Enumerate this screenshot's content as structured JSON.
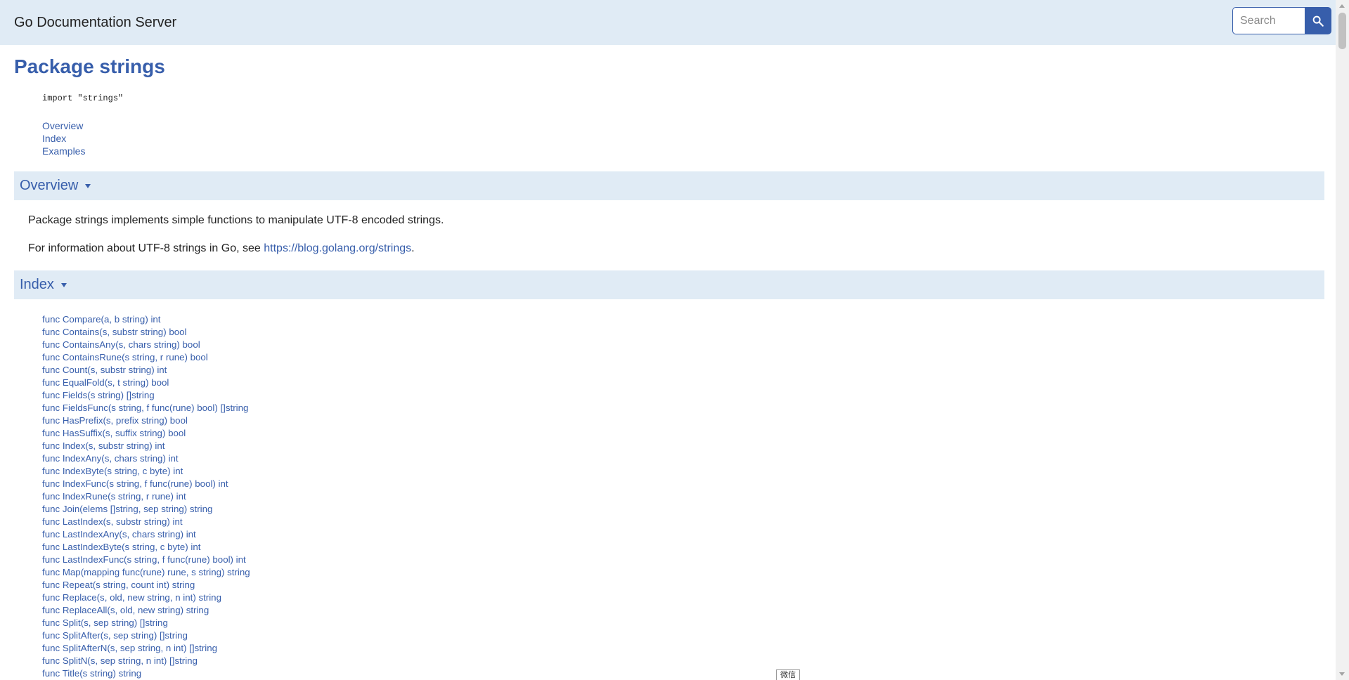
{
  "header": {
    "site_title": "Go Documentation Server",
    "search_placeholder": "Search",
    "search_icon": "search-icon"
  },
  "page": {
    "title": "Package strings",
    "import_line": "import \"strings\"",
    "toc": [
      "Overview",
      "Index",
      "Examples"
    ]
  },
  "overview": {
    "heading": "Overview",
    "toggle_icon": "triangle-down-icon",
    "paragraph1": "Package strings implements simple functions to manipulate UTF-8 encoded strings.",
    "paragraph2_prefix": "For information about UTF-8 strings in Go, see ",
    "paragraph2_link": "https://blog.golang.org/strings",
    "paragraph2_suffix": "."
  },
  "index": {
    "heading": "Index",
    "toggle_icon": "triangle-down-icon",
    "items": [
      "func Compare(a, b string) int",
      "func Contains(s, substr string) bool",
      "func ContainsAny(s, chars string) bool",
      "func ContainsRune(s string, r rune) bool",
      "func Count(s, substr string) int",
      "func EqualFold(s, t string) bool",
      "func Fields(s string) []string",
      "func FieldsFunc(s string, f func(rune) bool) []string",
      "func HasPrefix(s, prefix string) bool",
      "func HasSuffix(s, suffix string) bool",
      "func Index(s, substr string) int",
      "func IndexAny(s, chars string) int",
      "func IndexByte(s string, c byte) int",
      "func IndexFunc(s string, f func(rune) bool) int",
      "func IndexRune(s string, r rune) int",
      "func Join(elems []string, sep string) string",
      "func LastIndex(s, substr string) int",
      "func LastIndexAny(s, chars string) int",
      "func LastIndexByte(s string, c byte) int",
      "func LastIndexFunc(s string, f func(rune) bool) int",
      "func Map(mapping func(rune) rune, s string) string",
      "func Repeat(s string, count int) string",
      "func Replace(s, old, new string, n int) string",
      "func ReplaceAll(s, old, new string) string",
      "func Split(s, sep string) []string",
      "func SplitAfter(s, sep string) []string",
      "func SplitAfterN(s, sep string, n int) []string",
      "func SplitN(s, sep string, n int) []string",
      "func Title(s string) string"
    ]
  },
  "wechat_badge": "微信",
  "colors": {
    "accent": "#375eab",
    "header_bg": "#e0ebf5",
    "text": "#222222"
  }
}
